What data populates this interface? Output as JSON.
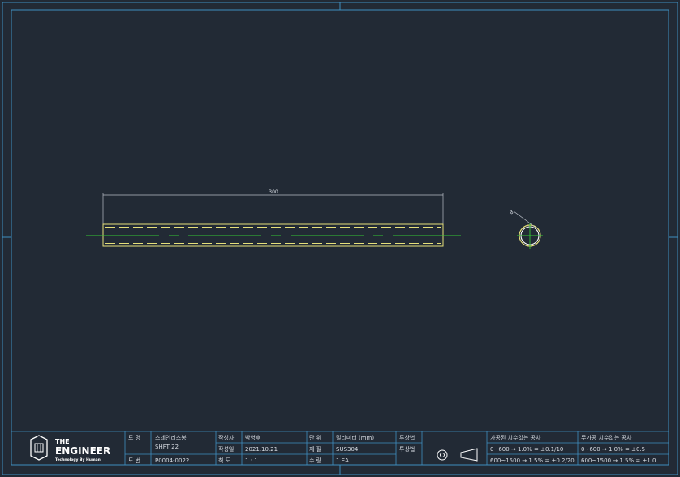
{
  "drawing": {
    "dimension_length": "300",
    "dimension_diameter": "8"
  },
  "title_block": {
    "logo": {
      "line1": "THE",
      "line2": "ENGINEER",
      "tagline": "Technology By Human"
    },
    "label_name": "도 명",
    "value_name_1": "스테인리스봉",
    "value_name_2": "SHFT 22",
    "label_no": "도 번",
    "value_no": "P0004-0022",
    "label_author": "작성자",
    "value_author": "박영후",
    "label_date": "작성일",
    "value_date": "2021.10.21",
    "label_scale": "척 도",
    "value_scale": "1 : 1",
    "label_unit": "단 위",
    "value_unit": "밀리미터 (mm)",
    "label_material": "재 질",
    "value_material": "SUS304",
    "label_qty": "수 량",
    "value_qty": "1 EA",
    "label_projection": "투상법",
    "label_projection2": "투상법",
    "machined_title": "가공된 치수없는 공차",
    "machined_row1": "0~600 → 1.0% = ±0.1/10",
    "machined_row2": "600~1500 → 1.5% = ±0.2/20",
    "unmachined_title": "무가공 치수없는 공차",
    "unmachined_row1": "0~600 → 1.0% = ±0.5",
    "unmachined_row2": "600~1500 → 1.5% = ±1.0"
  }
}
